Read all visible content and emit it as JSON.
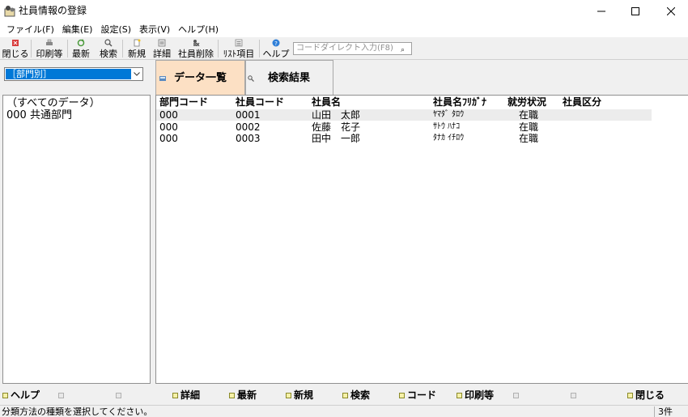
{
  "window": {
    "title": "社員情報の登録"
  },
  "menubar": {
    "items": [
      {
        "label": "ファイル(F)"
      },
      {
        "label": "編集(E)"
      },
      {
        "label": "設定(S)"
      },
      {
        "label": "表示(V)"
      },
      {
        "label": "ヘルプ(H)"
      }
    ]
  },
  "toolbar": {
    "close_label": "閉じる",
    "print_label": "印刷等",
    "refresh_label": "最新",
    "search_label": "検索",
    "new_label": "新規",
    "detail_label": "詳細",
    "delete_label": "社員削除",
    "list_items_label": "ﾘｽﾄ項目",
    "help_label": "ヘルプ",
    "direct_input_placeholder": "コードダイレクト入力(F8)"
  },
  "category_select": {
    "value": "［部門別］"
  },
  "tabs": [
    {
      "label": "データ一覧",
      "active": true
    },
    {
      "label": "検索結果",
      "active": false
    }
  ],
  "tree": {
    "items": [
      {
        "label": "（すべてのデータ）"
      },
      {
        "label": "000 共通部門"
      }
    ]
  },
  "table": {
    "columns": [
      "部門コード",
      "社員コード",
      "社員名",
      "社員名ﾌﾘｶﾞﾅ",
      "就労状況",
      "社員区分"
    ],
    "rows": [
      [
        "000",
        "0001",
        "山田　太郎",
        "ﾔﾏﾀﾞ ﾀﾛｳ",
        "在職",
        ""
      ],
      [
        "000",
        "0002",
        "佐藤　花子",
        "ｻﾄｳ ﾊﾅｺ",
        "在職",
        ""
      ],
      [
        "000",
        "0003",
        "田中　一郎",
        "ﾀﾅｶ ｲﾁﾛｳ",
        "在職",
        ""
      ]
    ]
  },
  "function_keys": {
    "help": "ヘルプ",
    "detail": "詳細",
    "refresh": "最新",
    "new": "新規",
    "search": "検索",
    "code": "コード",
    "print": "印刷等",
    "close": "閉じる"
  },
  "statusbar": {
    "message": "分類方法の種類を選択してください。",
    "count": "3件"
  },
  "colors": {
    "active_tab": "#fce0c4",
    "selection": "#0078d7",
    "row_alt": "#ececec"
  }
}
